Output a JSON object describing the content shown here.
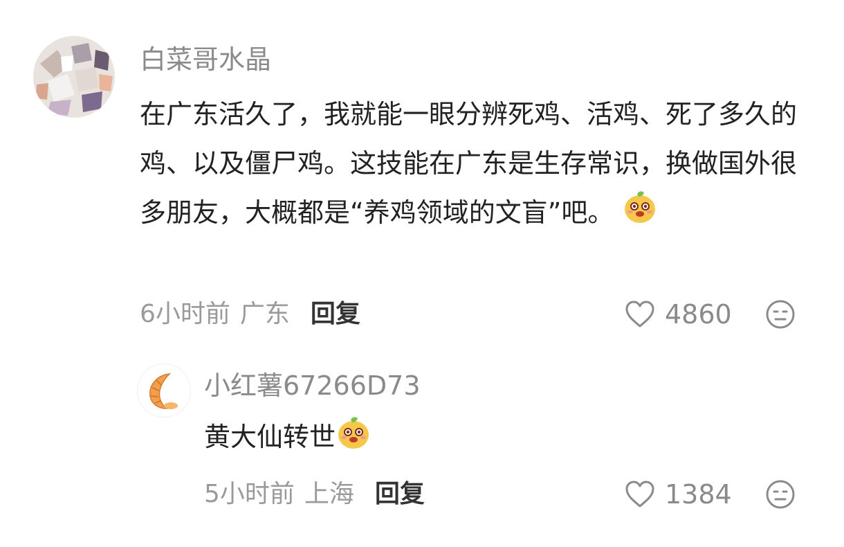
{
  "comments": [
    {
      "username": "白菜哥水晶",
      "text": "在广东活久了，我就能一眼分辨死鸡、活鸡、死了多久的鸡、以及僵尸鸡。这技能在广东是生存常识，换做国外很多朋友，大概都是“养鸡领域的文盲”吧。",
      "emoji": "mascot-emoji",
      "time": "6小时前",
      "location": "广东",
      "reply_label": "回复",
      "likes": "4860"
    },
    {
      "username": "小红薯67266D73",
      "text": "黄大仙转世",
      "emoji": "mascot-emoji",
      "time": "5小时前",
      "location": "上海",
      "reply_label": "回复",
      "likes": "1384"
    }
  ],
  "colors": {
    "username": "#8a8a8a",
    "text": "#222222",
    "meta": "#9a9a9a",
    "reply": "#333333",
    "icon": "#8a8a8a"
  },
  "icons": {
    "like": "heart-outline-icon",
    "dislike": "neutral-face-icon",
    "avatar_1": "crystals-avatar",
    "avatar_2": "croissant-avatar"
  }
}
